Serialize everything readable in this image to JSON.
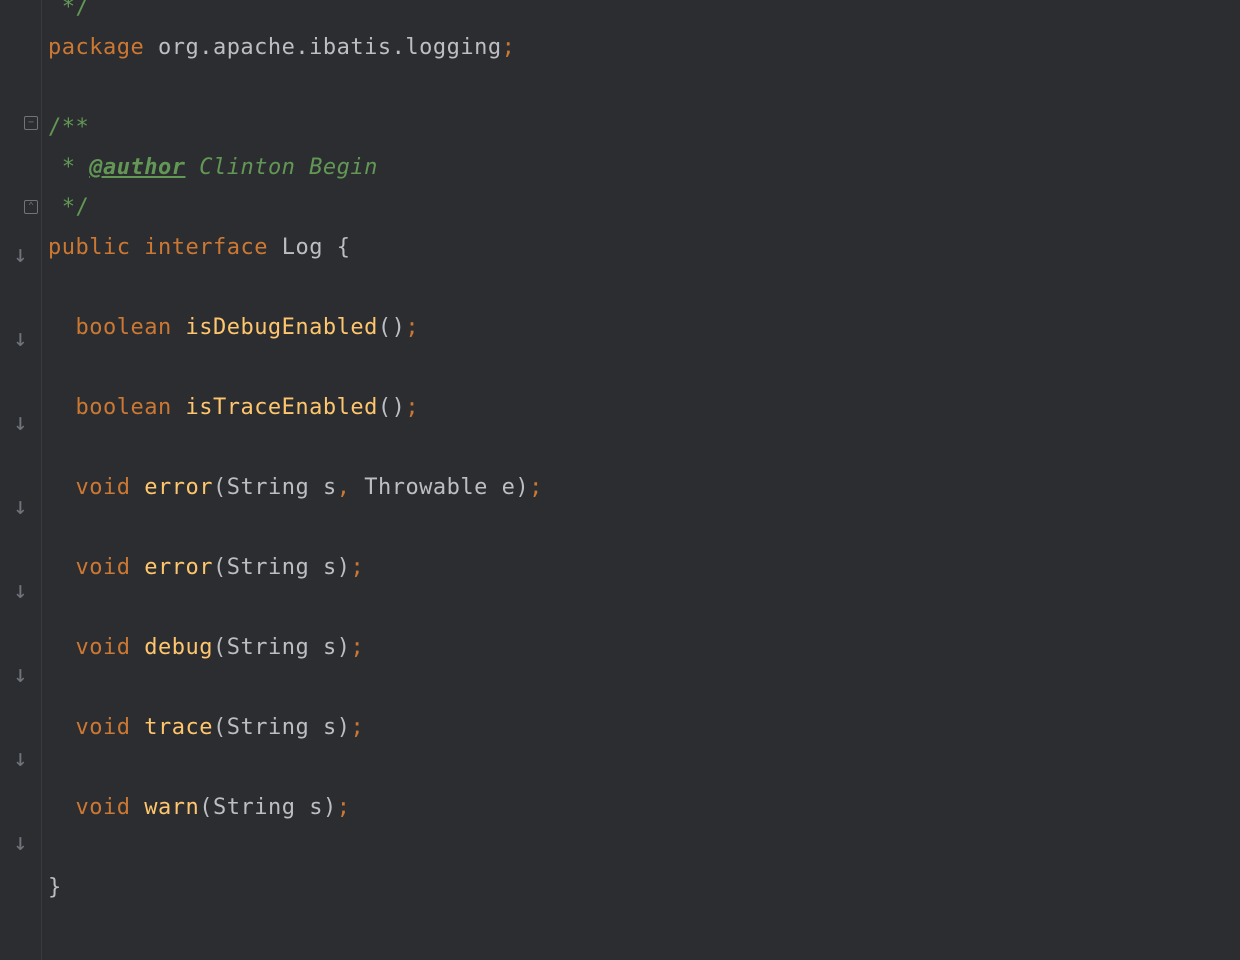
{
  "gutter": {
    "topComment": "*/",
    "foldMinus": "−",
    "foldClose": "⌃",
    "arrow": "↓"
  },
  "code": {
    "commentEnd": " */",
    "package_kw": "package",
    "package_name": " org.apache.ibatis.logging",
    "semi": ";",
    "docStart": "/**",
    "docLine": " * ",
    "authorTag": "@author",
    "authorName": " Clinton Begin",
    "docEnd": " */",
    "public_kw": "public",
    "interface_kw": "interface",
    "class_name": " Log ",
    "open_brace": "{",
    "boolean_kw": "boolean",
    "void_kw": "void",
    "m1": " isDebugEnabled",
    "m2": " isTraceEnabled",
    "m3": " error",
    "m4": " error",
    "m5": " debug",
    "m6": " trace",
    "m7": " warn",
    "paren_empty": "()",
    "paren_open": "(",
    "paren_close": ")",
    "string_type": "String",
    "throwable_type": "Throwable",
    "param_s": " s",
    "param_e": " e",
    "comma": ",",
    "space": " ",
    "indent1": "  ",
    "indent0": "",
    "close_brace": "}"
  }
}
